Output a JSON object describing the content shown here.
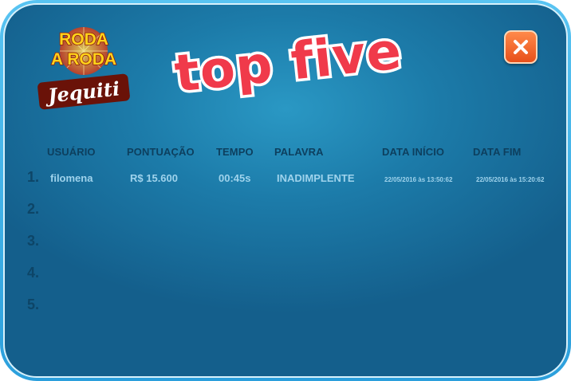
{
  "brand": {
    "logo_lines": [
      "RODA",
      "A RODA"
    ],
    "logo_script": "Jequiti"
  },
  "title": "top five",
  "colors": {
    "title_fill": "#f03a4a",
    "panel_border": "#59c4f2",
    "panel_bg": "#1c7ba9",
    "close_button": "#f26a2a",
    "header_text": "#0d3f5e",
    "value_text": "#9fd3ec"
  },
  "close_button": {
    "icon": "close-icon"
  },
  "table": {
    "headers": {
      "user": "USUÁRIO",
      "score": "PONTUAÇÃO",
      "time": "TEMPO",
      "word": "PALAVRA",
      "start_date": "DATA INÍCIO",
      "end_date": "DATA FIM"
    },
    "ranks": [
      "1.",
      "2.",
      "3.",
      "4.",
      "5."
    ],
    "rows": [
      {
        "user": "filomena",
        "score": "R$ 15.600",
        "time": "00:45s",
        "word": "INADIMPLENTE",
        "start_date": "22/05/2016 às 13:50:62",
        "end_date": "22/05/2016 às 15:20:62"
      }
    ]
  }
}
